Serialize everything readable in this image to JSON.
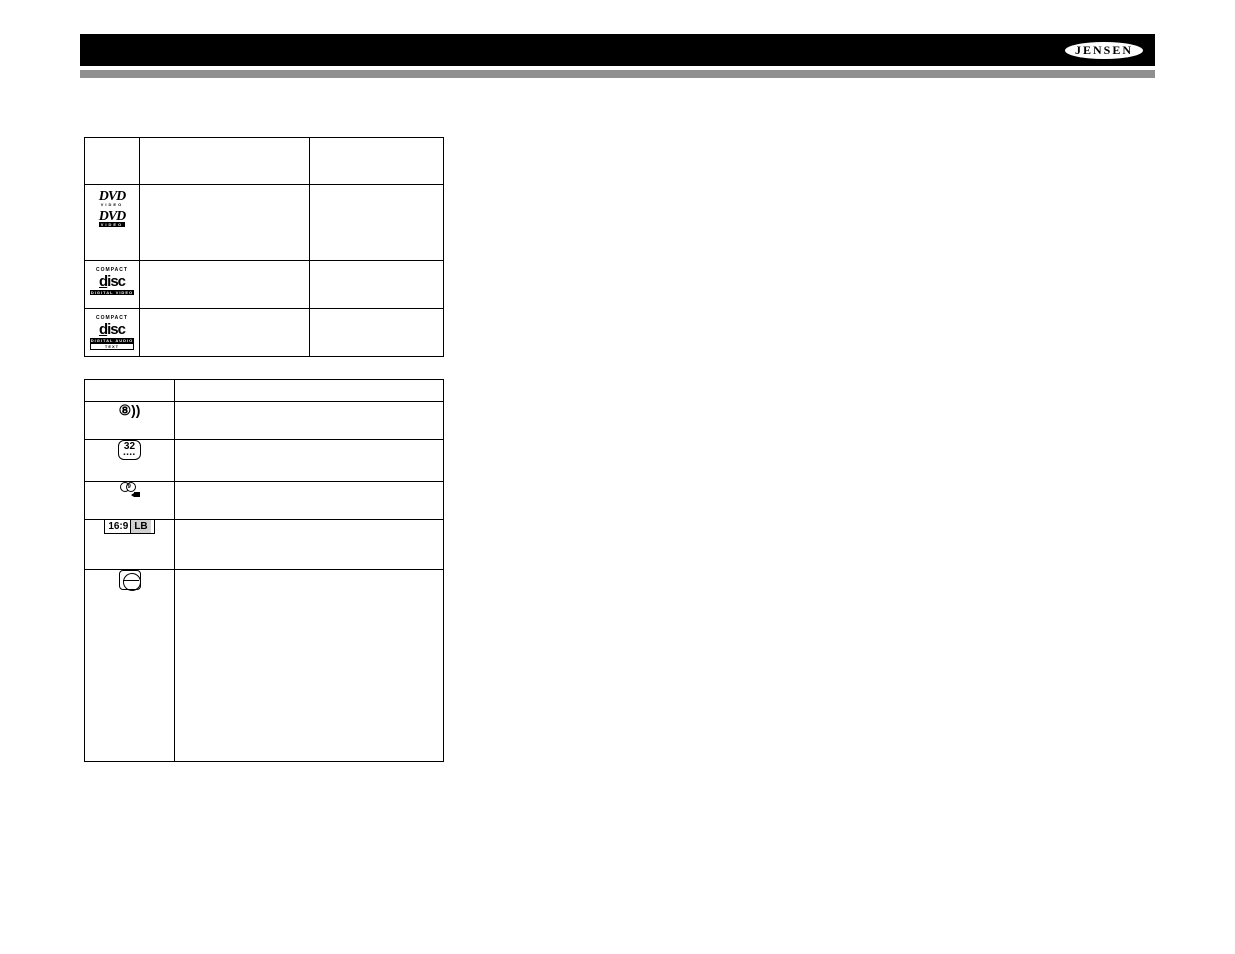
{
  "brand": "JENSEN",
  "table1": {
    "headers": {
      "symbol": "",
      "content": "",
      "size": ""
    },
    "rows": {
      "dvd": {
        "content": "",
        "size": ""
      },
      "vcd": {
        "content": "",
        "size": ""
      },
      "cd": {
        "content": "",
        "size": ""
      }
    }
  },
  "table2": {
    "headers": {
      "symbol": "",
      "meaning": ""
    },
    "rows": {
      "voices": {
        "meaning": ""
      },
      "subs": {
        "number": "32",
        "meaning": ""
      },
      "angles": {
        "number": "9",
        "meaning": ""
      },
      "aspect": {
        "ratio": "16:9",
        "badge": "LB",
        "meaning": ""
      },
      "region": {
        "meaning": ""
      }
    }
  }
}
